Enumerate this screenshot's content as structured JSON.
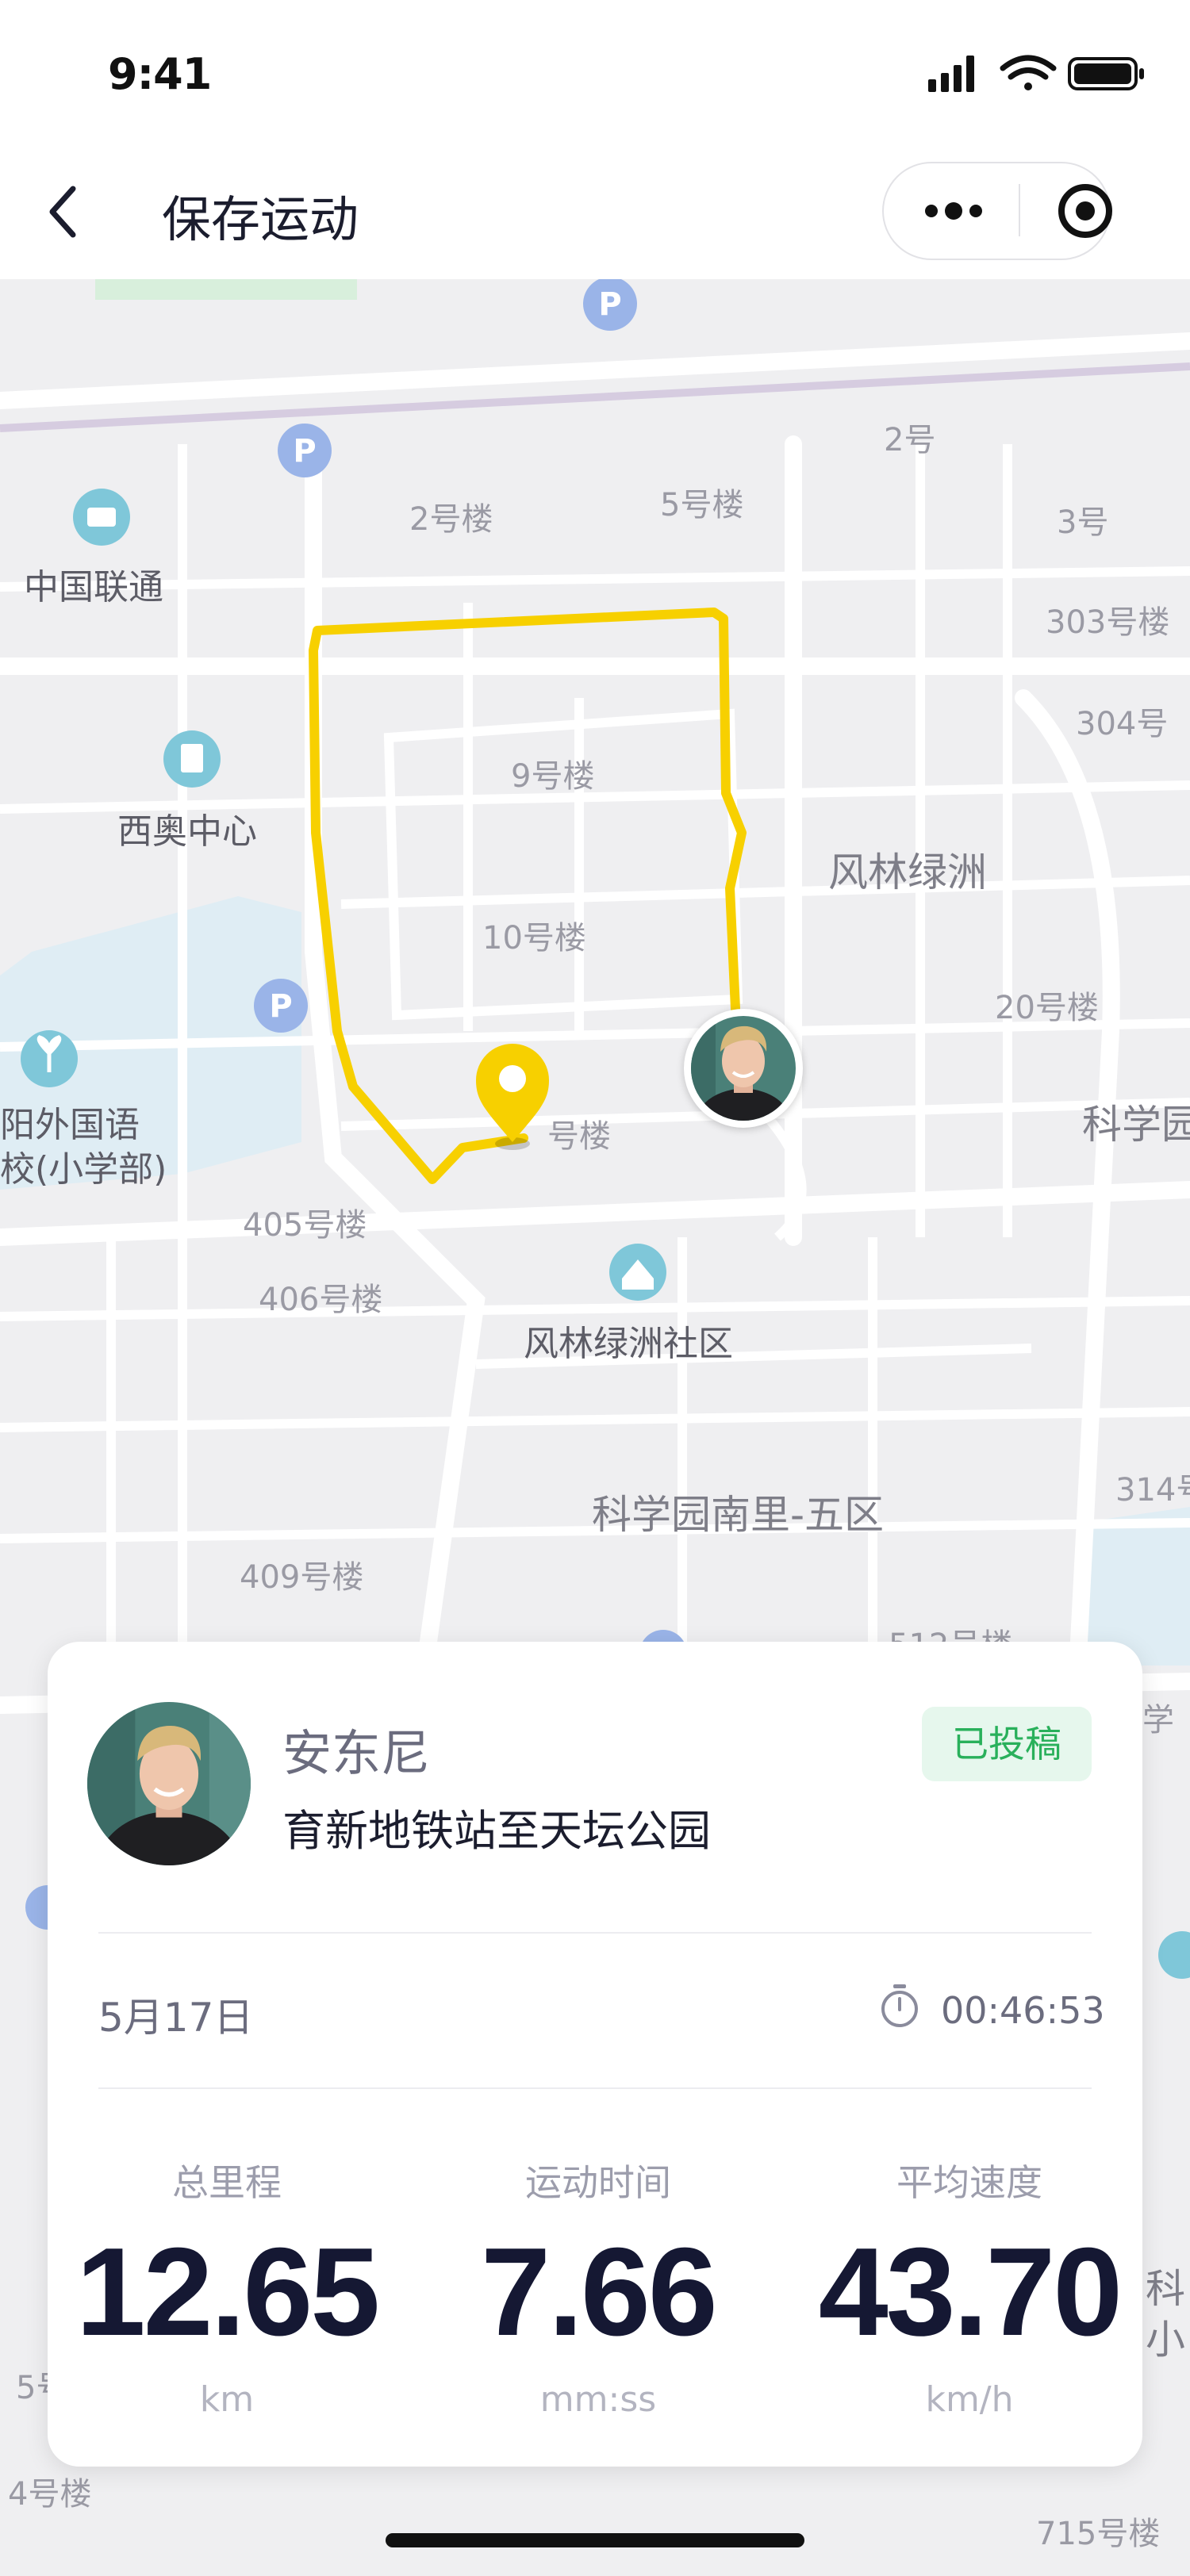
{
  "status_bar": {
    "time": "9:41"
  },
  "nav": {
    "title": "保存运动"
  },
  "map": {
    "labels": [
      "2号楼",
      "5号楼",
      "2号",
      "3号",
      "303号楼",
      "304号",
      "中国联通",
      "9号楼",
      "西奥中心",
      "风林绿洲",
      "10号楼",
      "20号楼",
      "阳外国语",
      "校(小学部)",
      "科学园",
      "号楼",
      "405号楼",
      "406号楼",
      "风林绿洲社区",
      "科学园南里-五区",
      "314号",
      "409号楼",
      "512号楼",
      "4号楼",
      "715号楼",
      "5号",
      "学",
      "科",
      "小"
    ]
  },
  "card": {
    "user_name": "安东尼",
    "route_name": "育新地铁站至天坛公园",
    "badge": "已投稿",
    "date": "5月17日",
    "duration": "00:46:53",
    "stats": [
      {
        "label": "总里程",
        "value": "12.65",
        "unit": "km"
      },
      {
        "label": "运动时间",
        "value": "7.66",
        "unit": "mm:ss"
      },
      {
        "label": "平均速度",
        "value": "43.70",
        "unit": "km/h"
      }
    ]
  },
  "colors": {
    "route": "#f7d000",
    "badge_bg": "#e6f7ed",
    "badge_text": "#29b05b",
    "title_text": "#1b1d2e"
  }
}
